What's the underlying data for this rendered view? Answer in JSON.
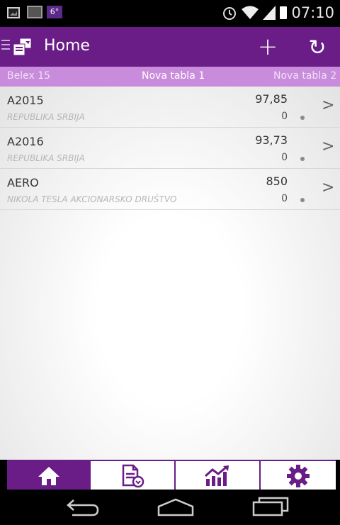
{
  "statusbar": {
    "temperature": "6°",
    "time": "07:10",
    "icons": [
      "gallery-icon",
      "image-icon",
      "alarm-icon",
      "wifi-icon",
      "signal-icon",
      "battery-icon"
    ]
  },
  "appbar": {
    "title": "Home",
    "add_icon": "+",
    "refresh_icon": "↻"
  },
  "tabs": [
    {
      "label": "Belex 15"
    },
    {
      "label": "Nova tabla 1"
    },
    {
      "label": "Nova tabla 2"
    }
  ],
  "rows": [
    {
      "symbol": "A2015",
      "issuer": "REPUBLIKA SRBIJA",
      "price": "97,85",
      "change": "0"
    },
    {
      "symbol": "A2016",
      "issuer": "REPUBLIKA SRBIJA",
      "price": "93,73",
      "change": "0"
    },
    {
      "symbol": "AERO",
      "issuer": "NIKOLA TESLA AKCIONARSKO DRUŠTVO",
      "price": "850",
      "change": "0"
    }
  ],
  "bottom_tabs": [
    {
      "name": "home-icon"
    },
    {
      "name": "document-icon"
    },
    {
      "name": "chart-icon"
    },
    {
      "name": "settings-icon"
    }
  ],
  "colors": {
    "primary": "#6a1d86",
    "tab_bar": "#c98bdc"
  }
}
